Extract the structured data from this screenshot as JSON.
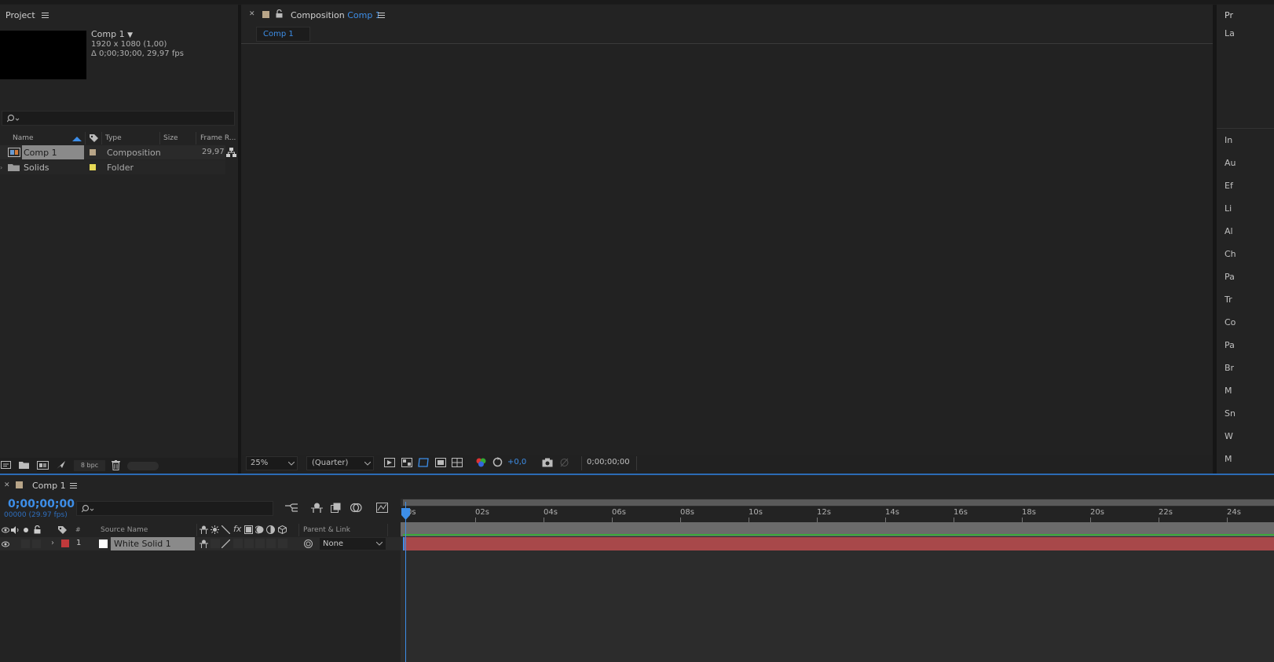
{
  "project": {
    "title": "Project",
    "comp_name": "Comp 1",
    "comp_dims": "1920 x 1080 (1,00)",
    "comp_duration": "Δ 0;00;30;00, 29,97 fps",
    "columns": {
      "name": "Name",
      "type": "Type",
      "size": "Size",
      "frame_rate": "Frame R..."
    },
    "items": [
      {
        "name": "Comp 1",
        "type": "Composition",
        "frame_rate": "29,97",
        "label_color": "#b8a588"
      },
      {
        "name": "Solids",
        "type": "Folder",
        "frame_rate": "",
        "label_color": "#e6d955"
      }
    ],
    "bpc": "8 bpc"
  },
  "composition": {
    "panel_prefix": "Composition",
    "panel_comp": "Comp 1",
    "tab": "Comp 1",
    "zoom": "25%",
    "resolution": "(Quarter)",
    "exposure": "+0,0",
    "timecode": "0;00;00;00"
  },
  "right_panel": {
    "items": [
      "Pr",
      "La",
      "In",
      "Au",
      "Ef",
      "Li",
      "Al",
      "Ch",
      "Pa",
      "Tr",
      "Co",
      "Pa",
      "Br",
      "M",
      "Sn",
      "W",
      "M"
    ]
  },
  "timeline": {
    "tab": "Comp 1",
    "timecode": "0;00;00;00",
    "frame_info": "00000 (29.97 fps)",
    "columns": {
      "number": "#",
      "source_name": "Source Name",
      "parent": "Parent & Link"
    },
    "layers": [
      {
        "number": "1",
        "name": "White Solid 1",
        "parent": "None",
        "label_color": "#c0393b"
      }
    ],
    "ruler": [
      "0s",
      "02s",
      "04s",
      "06s",
      "08s",
      "10s",
      "12s",
      "14s",
      "16s",
      "18s",
      "20s",
      "22s",
      "24s"
    ]
  },
  "colors": {
    "accent": "#3d8ee8",
    "layer_bar": "#a8484a",
    "work_area": "#3aa83a"
  }
}
